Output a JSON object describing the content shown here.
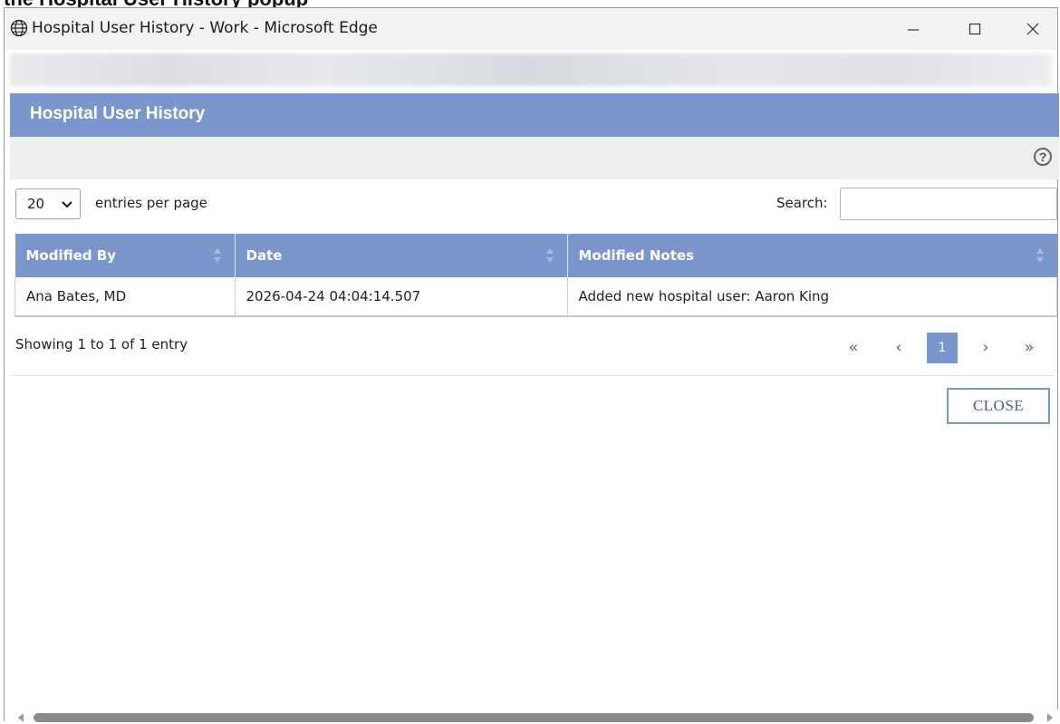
{
  "top_caption": "the Hospital User History popup",
  "window": {
    "title": "Hospital User History - Work - Microsoft Edge",
    "icon": "globe-icon"
  },
  "dialog": {
    "title": "Hospital User History",
    "help_icon": "?"
  },
  "controls": {
    "page_size": "20",
    "entries_label": "entries per page",
    "search_label": "Search:",
    "search_value": ""
  },
  "table": {
    "columns": [
      "Modified By",
      "Date",
      "Modified Notes"
    ],
    "rows": [
      [
        "Ana Bates, MD",
        "2026-04-24 04:04:14.507",
        "Added new hospital user: Aaron King"
      ]
    ]
  },
  "footer": {
    "showing": "Showing 1 to 1 of 1 entry",
    "pager": {
      "first": "«",
      "prev": "‹",
      "current": "1",
      "next": "›",
      "last": "»"
    }
  },
  "actions": {
    "close_label": "CLOSE"
  },
  "colors": {
    "accent": "#7b96cd",
    "help_bar": "#eeeeee"
  }
}
